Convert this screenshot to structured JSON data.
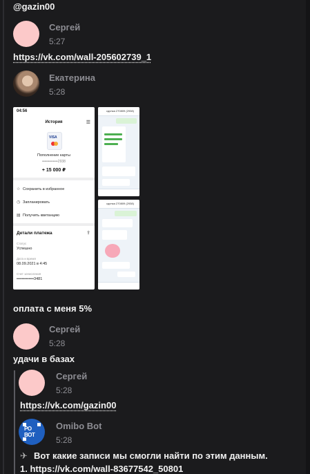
{
  "messages": {
    "top_username": "@gazin00",
    "m1": {
      "author": "Сергей",
      "time": "5:27",
      "link": "https://vk.com/wall-205602739_1"
    },
    "m2": {
      "author": "Екатерина",
      "time": "5:28"
    },
    "m3": {
      "text": "оплата с меня 5%"
    },
    "m4": {
      "author": "Сергей",
      "time": "5:28",
      "text": "удачи в базах"
    },
    "quoted": {
      "q1": {
        "author": "Сергей",
        "time": "5:28",
        "link": "https://vk.com/gazin00"
      },
      "q2": {
        "author": "Omibo Bot",
        "time": "5:28",
        "icon_glyph": "✈",
        "text": "Вот какие записи мы смогли найти по этим данным.",
        "result_1": "1. https://vk.com/wall-83677542_50801"
      }
    }
  },
  "phone_screenshot": {
    "status_time": "04:56",
    "title": "История",
    "card_brand": "VISA",
    "operation": "Пополнение карты",
    "card_mask": "•••••••••••••2938",
    "amount": "+ 15 000 ₽",
    "actions": [
      "Сохранить в избранное",
      "Запланировать",
      "Получить квитанцию"
    ],
    "details_title": "Детали платежа",
    "status_label": "Статус",
    "status_value": "Успешно",
    "date_label": "Дата и время",
    "date_value": "08.09.2021 в 4:45",
    "account_label": "Счет зачисления",
    "account_value": "•••••••••••••3481"
  },
  "chat_screenshot": {
    "header": "сделка 270809 (2938)"
  },
  "colors": {
    "background": "#1b1b1d",
    "text": "#f2f2f2",
    "muted": "#8d8d93",
    "avatar_placeholder": "#fcc9c9",
    "bot_avatar": "#1f5fbf"
  },
  "icons": {
    "bot_message_icon": "plane-icon",
    "phone_actions": [
      "star-icon",
      "clock-icon",
      "receipt-icon"
    ],
    "share": "share-icon",
    "menu": "menu-icon"
  }
}
